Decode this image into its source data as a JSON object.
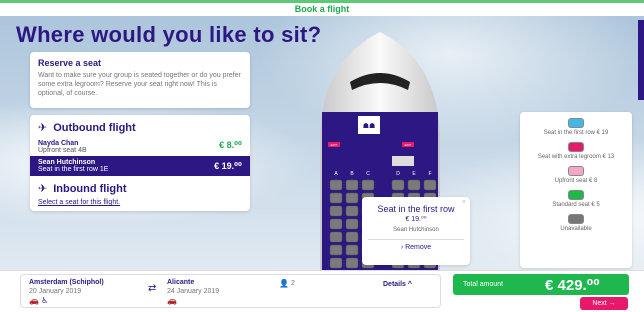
{
  "header": {
    "book_label": "Book a flight"
  },
  "page_title": "Where would you like to sit?",
  "reserve": {
    "title": "Reserve a seat",
    "description": "Want to make sure your group is seated together or do you prefer some extra legroom? Reserve your seat right now! This is optional, of course."
  },
  "outbound": {
    "title": "Outbound flight",
    "passengers": [
      {
        "name": "Nayda Chan",
        "detail": "Upfront seat 4B",
        "price": "€ 8.⁰⁰"
      },
      {
        "name": "Sean Hutchinson",
        "detail": "Seat in the first row 1E",
        "price": "€ 19.⁰⁰"
      }
    ]
  },
  "inbound": {
    "title": "Inbound flight",
    "link": "Select a seat for this flight."
  },
  "seat_columns": [
    "A",
    "B",
    "C",
    "D",
    "E",
    "F"
  ],
  "exit_label": "EXIT",
  "legend": [
    {
      "label": "Seat in the first row € 19",
      "color": "#3fb8e8"
    },
    {
      "label": "Seat with extra legroom € 13",
      "color": "#e8196b"
    },
    {
      "label": "Upfront seat € 8",
      "color": "#f2a7c9"
    },
    {
      "label": "Standard seat € 5",
      "color": "#1fb84f"
    },
    {
      "label": "Unavailable",
      "color": "#777777"
    }
  ],
  "popup": {
    "title": "Seat in the first row",
    "price": "€ 19.⁰⁰",
    "passenger": "Sean Hutchinson",
    "remove": "Remove",
    "close": "×"
  },
  "trip": {
    "from": "Amsterdam (Schiphol)",
    "from_date": "20 January 2019",
    "to": "Alicante",
    "to_date": "24 January 2019",
    "passenger_count": "2",
    "details": "Details"
  },
  "total": {
    "label": "Total amount",
    "amount": "€ 429.⁰⁰"
  },
  "next_label": "Next"
}
